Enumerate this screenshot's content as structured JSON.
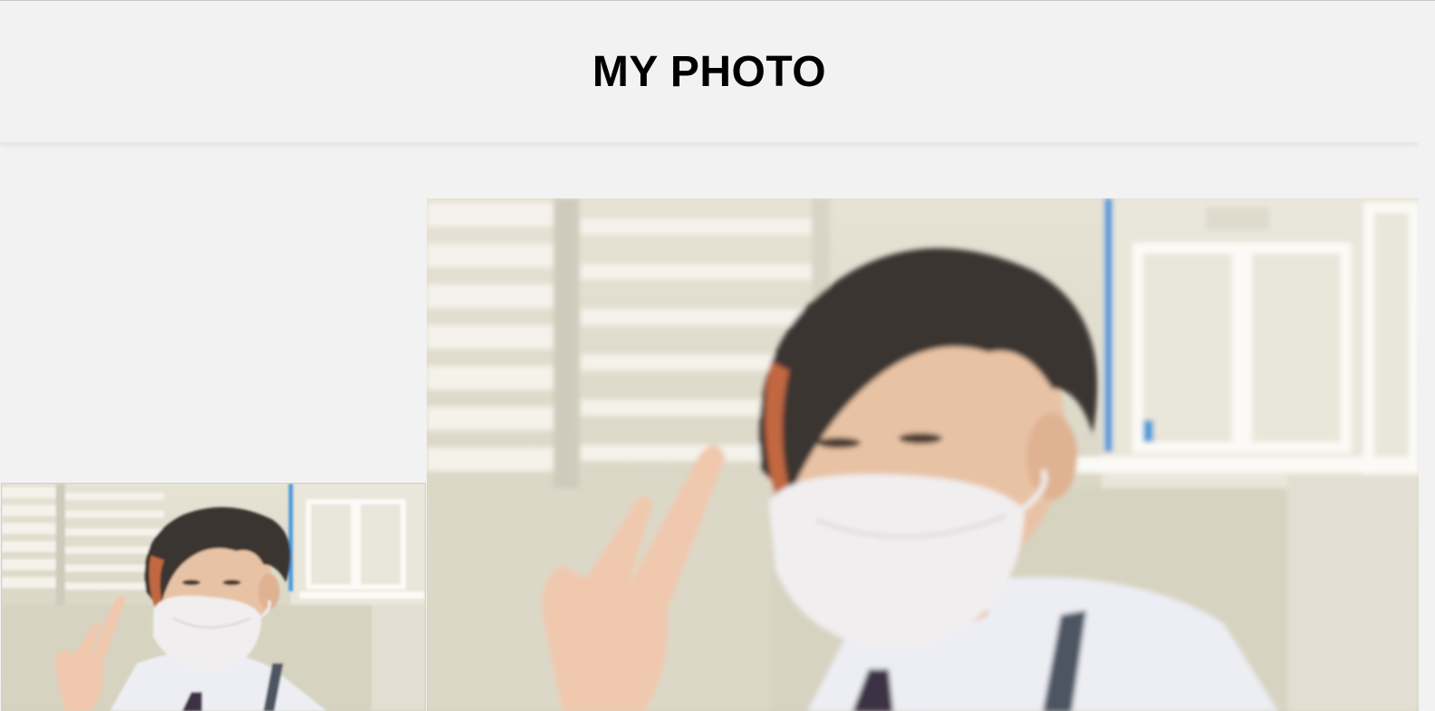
{
  "page": {
    "title": "MY PHOTO"
  },
  "photos": [
    {
      "label": "thumbnail-photo"
    },
    {
      "label": "large-photo"
    }
  ],
  "colors": {
    "background": "#f2f2f2",
    "title": "#000000"
  }
}
